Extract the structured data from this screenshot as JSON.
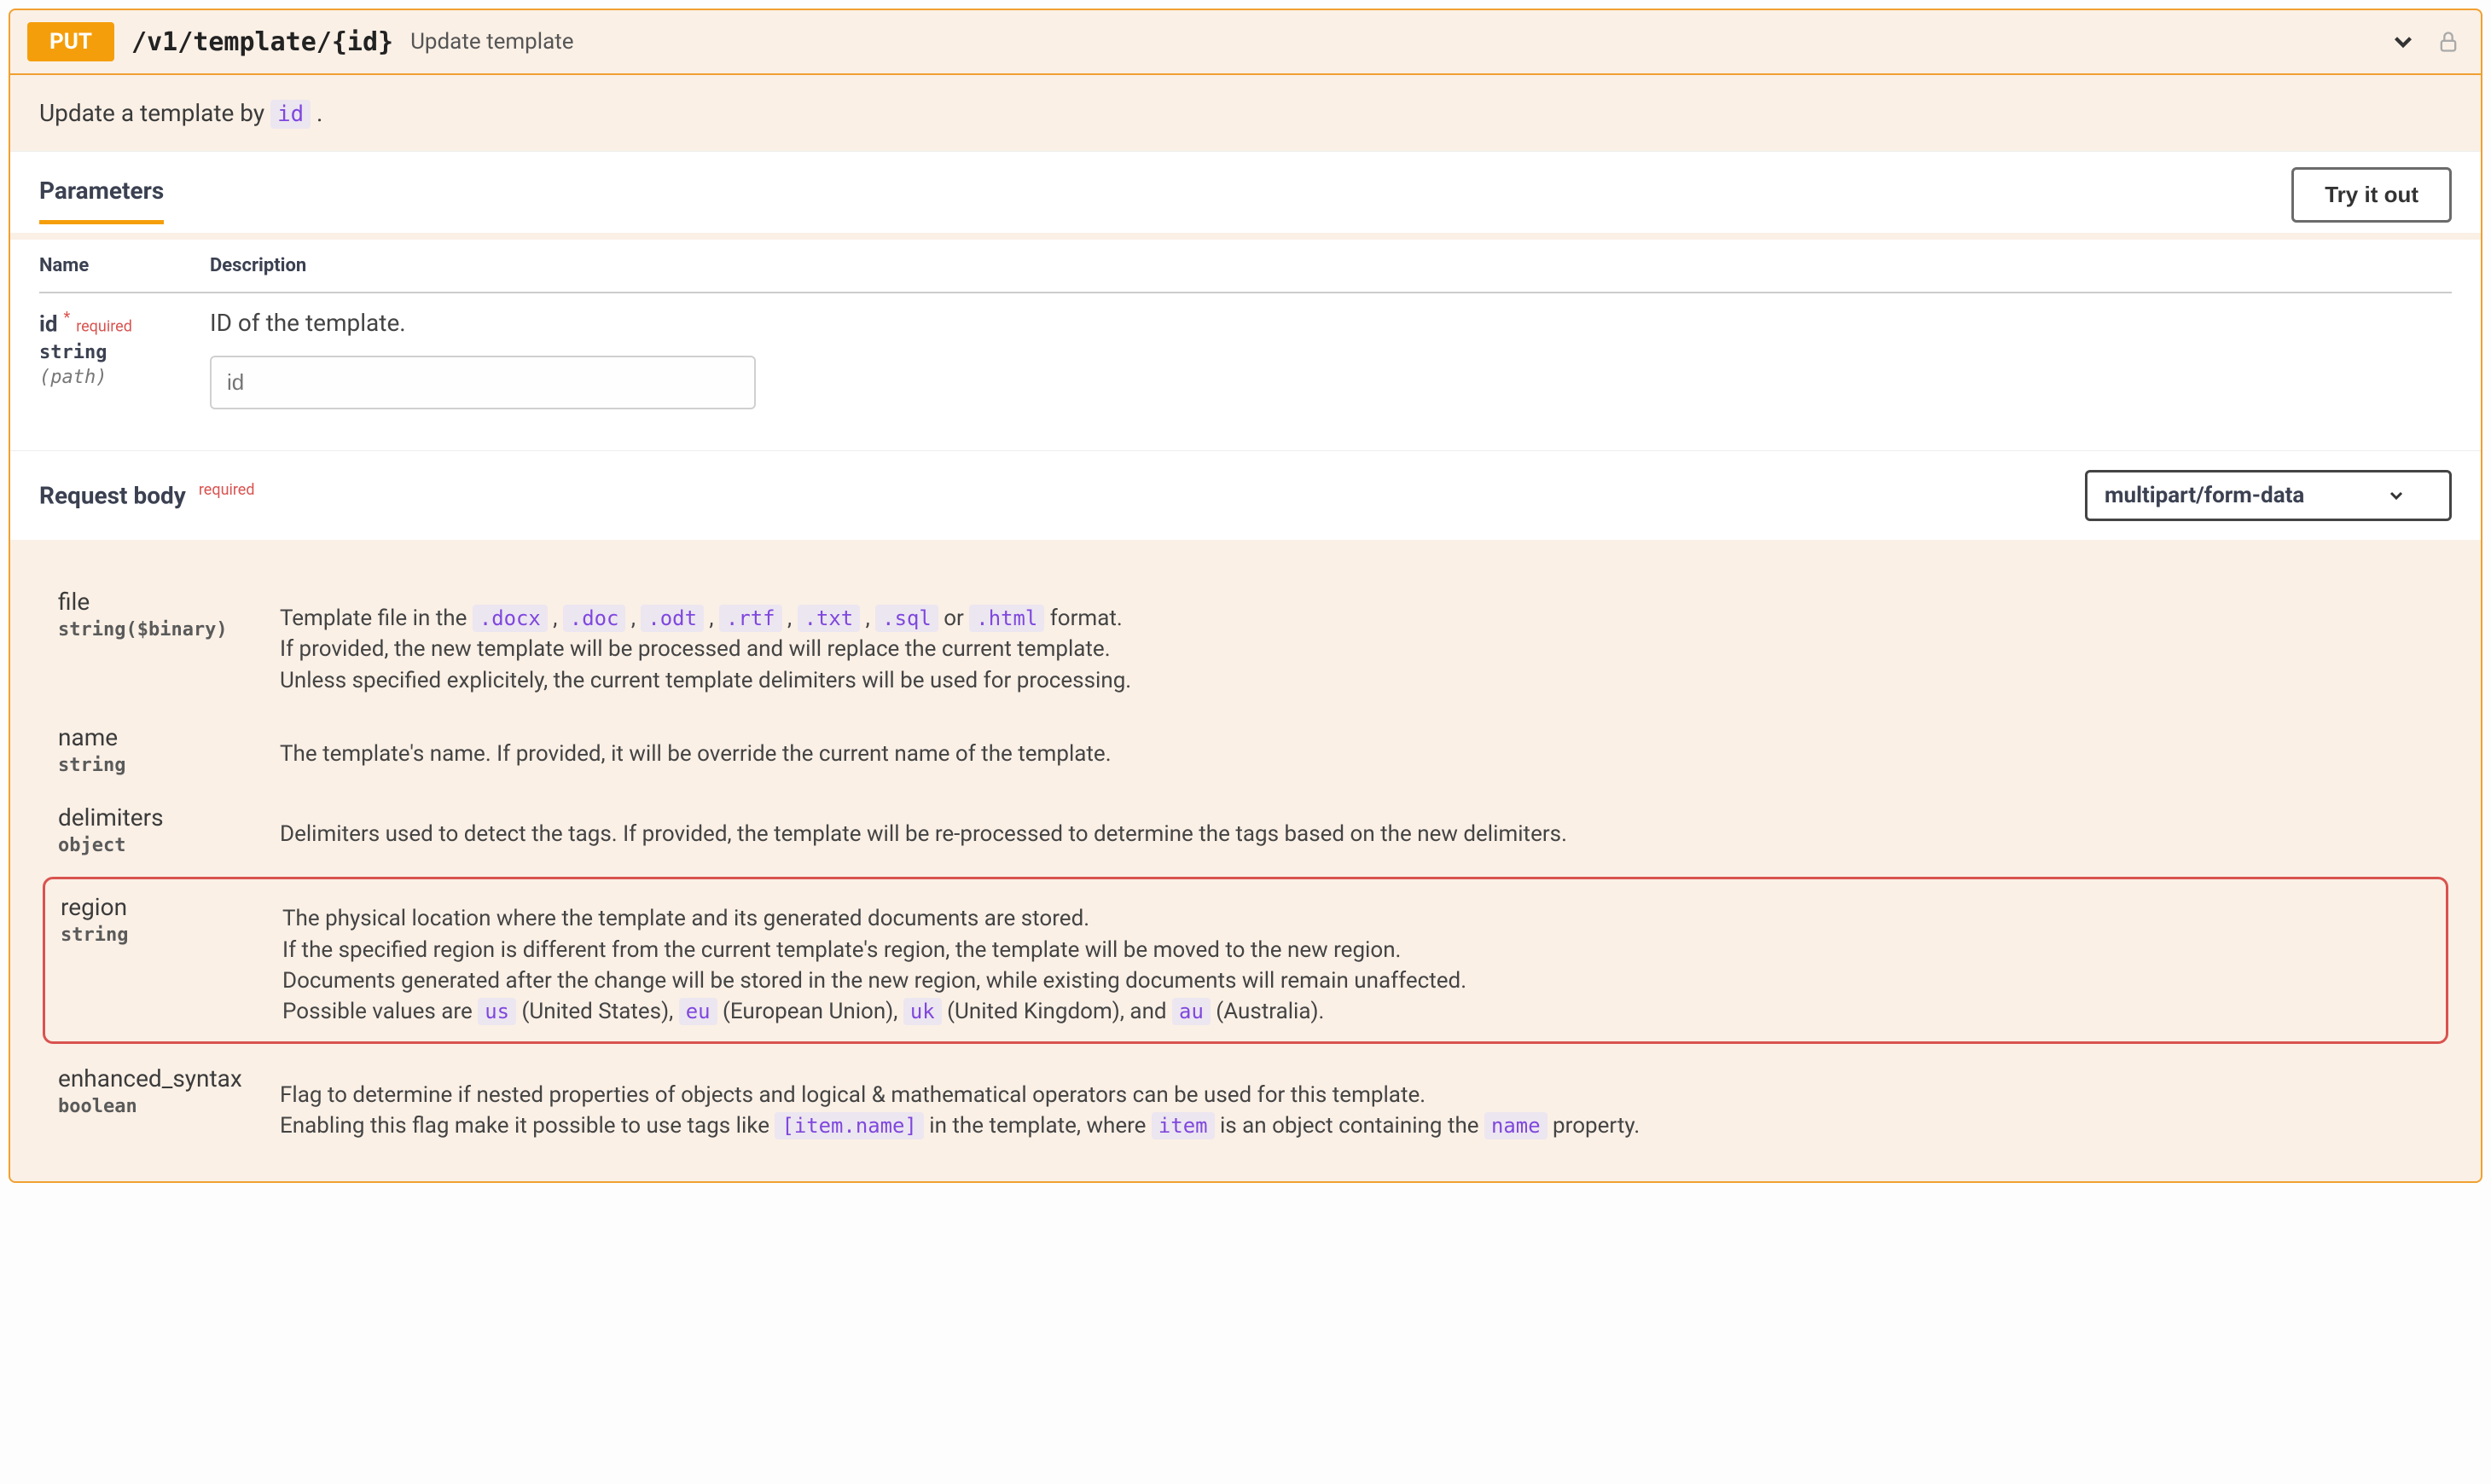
{
  "op": {
    "method": "PUT",
    "path": "/v1/template/{id}",
    "summary": "Update template",
    "description_pre": "Update a template by ",
    "description_chip": "id",
    "description_post": " ."
  },
  "params_section": {
    "title": "Parameters",
    "try_btn": "Try it out",
    "col_name": "Name",
    "col_desc": "Description"
  },
  "param_id": {
    "name": "id",
    "req_star": "*",
    "req_label": "required",
    "type": "string",
    "location": "(path)",
    "desc": "ID of the template.",
    "placeholder": "id"
  },
  "reqbody": {
    "title": "Request body",
    "req_label": "required",
    "content_type": "multipart/form-data"
  },
  "body": {
    "file": {
      "name": "file",
      "type": "string($binary)",
      "desc_pre": "Template file in the ",
      "ext1": ".docx",
      "sep": " , ",
      "ext2": ".doc",
      "ext3": ".odt",
      "ext4": ".rtf",
      "ext5": ".txt",
      "ext6": ".sql",
      "or": " or ",
      "ext7": ".html",
      "desc_post": " format.",
      "line2": "If provided, the new template will be processed and will replace the current template.",
      "line3": "Unless specified explicitely, the current template delimiters will be used for processing."
    },
    "name": {
      "name": "name",
      "type": "string",
      "desc": "The template's name. If provided, it will be override the current name of the template."
    },
    "delimiters": {
      "name": "delimiters",
      "type": "object",
      "desc": "Delimiters used to detect the tags. If provided, the template will be re-processed to determine the tags based on the new delimiters."
    },
    "region": {
      "name": "region",
      "type": "string",
      "line1": "The physical location where the template and its generated documents are stored.",
      "line2": "If the specified region is different from the current template's region, the template will be moved to the new region.",
      "line3": "Documents generated after the change will be stored in the new region, while existing documents will remain unaffected.",
      "line4_pre": "Possible values are ",
      "v1": "us",
      "v1_lbl": " (United States), ",
      "v2": "eu",
      "v2_lbl": " (European Union), ",
      "v3": "uk",
      "v3_lbl": " (United Kingdom), and ",
      "v4": "au",
      "v4_lbl": " (Australia)."
    },
    "enhanced": {
      "name": "enhanced_syntax",
      "type": "boolean",
      "line1": "Flag to determine if nested properties of objects and logical & mathematical operators can be used for this template.",
      "line2_pre": "Enabling this flag make it possible to use tags like ",
      "chip1": "[item.name]",
      "line2_mid": " in the template, where ",
      "chip2": "item",
      "line2_mid2": " is an object containing the ",
      "chip3": "name",
      "line2_post": " property."
    }
  }
}
